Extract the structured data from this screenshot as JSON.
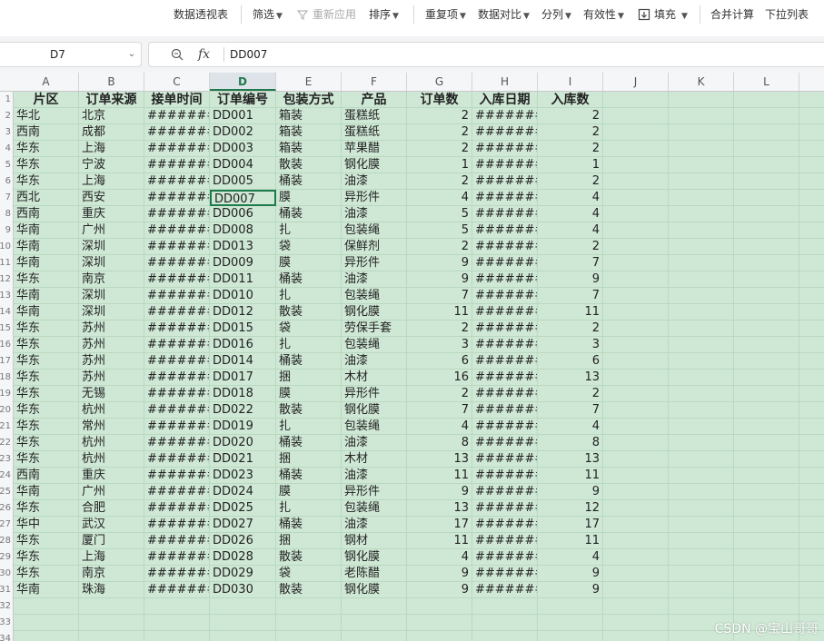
{
  "toolbar": {
    "pivot_table": "数据透视表",
    "filter": "筛选",
    "reapply": "重新应用",
    "sort": "排序",
    "duplicates": "重复项",
    "data_compare": "数据对比",
    "split": "分列",
    "validity": "有效性",
    "fill": "填充",
    "merge_calc": "合并计算",
    "dropdown_list": "下拉列表"
  },
  "formula_bar": {
    "name_box": "D7",
    "fx_label": "fx",
    "value": "DD007"
  },
  "sheet": {
    "columns": [
      "A",
      "B",
      "C",
      "D",
      "E",
      "F",
      "G",
      "H",
      "I",
      "J",
      "K",
      "L"
    ],
    "selected_column": "D",
    "row_numbers": [
      "1",
      "2",
      "3",
      "4",
      "5",
      "6",
      "7",
      "8",
      "9",
      "10",
      "11",
      "12",
      "13",
      "14",
      "15",
      "16",
      "17",
      "18",
      "19",
      "20",
      "21",
      "22",
      "23",
      "24",
      "25",
      "26",
      "27",
      "28",
      "29",
      "30",
      "31",
      "32",
      "33",
      "34"
    ],
    "headers": [
      "片区",
      "订单来源",
      "接单时间",
      "订单编号",
      "包装方式",
      "产品",
      "订单数",
      "入库日期",
      "入库数"
    ],
    "rows": [
      [
        "华北",
        "北京",
        "########",
        "DD001",
        "箱装",
        "蛋糕纸",
        "2",
        "########",
        "2"
      ],
      [
        "西南",
        "成都",
        "########",
        "DD002",
        "箱装",
        "蛋糕纸",
        "2",
        "########",
        "2"
      ],
      [
        "华东",
        "上海",
        "########",
        "DD003",
        "箱装",
        "苹果醋",
        "2",
        "########",
        "2"
      ],
      [
        "华东",
        "宁波",
        "########",
        "DD004",
        "散装",
        "钢化膜",
        "1",
        "########",
        "1"
      ],
      [
        "华东",
        "上海",
        "########",
        "DD005",
        "桶装",
        "油漆",
        "2",
        "########",
        "2"
      ],
      [
        "西北",
        "西安",
        "########",
        "DD007",
        "膜",
        "异形件",
        "4",
        "########",
        "4"
      ],
      [
        "西南",
        "重庆",
        "########",
        "DD006",
        "桶装",
        "油漆",
        "5",
        "########",
        "4"
      ],
      [
        "华南",
        "广州",
        "########",
        "DD008",
        "扎",
        "包装绳",
        "5",
        "########",
        "4"
      ],
      [
        "华南",
        "深圳",
        "########",
        "DD013",
        "袋",
        "保鲜剂",
        "2",
        "########",
        "2"
      ],
      [
        "华南",
        "深圳",
        "########",
        "DD009",
        "膜",
        "异形件",
        "9",
        "########",
        "7"
      ],
      [
        "华东",
        "南京",
        "########",
        "DD011",
        "桶装",
        "油漆",
        "9",
        "########",
        "9"
      ],
      [
        "华南",
        "深圳",
        "########",
        "DD010",
        "扎",
        "包装绳",
        "7",
        "########",
        "7"
      ],
      [
        "华南",
        "深圳",
        "########",
        "DD012",
        "散装",
        "钢化膜",
        "11",
        "########",
        "11"
      ],
      [
        "华东",
        "苏州",
        "########",
        "DD015",
        "袋",
        "劳保手套",
        "2",
        "########",
        "2"
      ],
      [
        "华东",
        "苏州",
        "########",
        "DD016",
        "扎",
        "包装绳",
        "3",
        "########",
        "3"
      ],
      [
        "华东",
        "苏州",
        "########",
        "DD014",
        "桶装",
        "油漆",
        "6",
        "########",
        "6"
      ],
      [
        "华东",
        "苏州",
        "########",
        "DD017",
        "捆",
        "木材",
        "16",
        "########",
        "13"
      ],
      [
        "华东",
        "无锡",
        "########",
        "DD018",
        "膜",
        "异形件",
        "2",
        "########",
        "2"
      ],
      [
        "华东",
        "杭州",
        "########",
        "DD022",
        "散装",
        "钢化膜",
        "7",
        "########",
        "7"
      ],
      [
        "华东",
        "常州",
        "########",
        "DD019",
        "扎",
        "包装绳",
        "4",
        "########",
        "4"
      ],
      [
        "华东",
        "杭州",
        "########",
        "DD020",
        "桶装",
        "油漆",
        "8",
        "########",
        "8"
      ],
      [
        "华东",
        "杭州",
        "########",
        "DD021",
        "捆",
        "木材",
        "13",
        "########",
        "13"
      ],
      [
        "西南",
        "重庆",
        "########",
        "DD023",
        "桶装",
        "油漆",
        "11",
        "########",
        "11"
      ],
      [
        "华南",
        "广州",
        "########",
        "DD024",
        "膜",
        "异形件",
        "9",
        "########",
        "9"
      ],
      [
        "华东",
        "合肥",
        "########",
        "DD025",
        "扎",
        "包装绳",
        "13",
        "########",
        "12"
      ],
      [
        "华中",
        "武汉",
        "########",
        "DD027",
        "桶装",
        "油漆",
        "17",
        "########",
        "17"
      ],
      [
        "华东",
        "厦门",
        "########",
        "DD026",
        "捆",
        "钢材",
        "11",
        "########",
        "11"
      ],
      [
        "华东",
        "上海",
        "########",
        "DD028",
        "散装",
        "钢化膜",
        "4",
        "########",
        "4"
      ],
      [
        "华东",
        "南京",
        "########",
        "DD029",
        "袋",
        "老陈醋",
        "9",
        "########",
        "9"
      ],
      [
        "华南",
        "珠海",
        "########",
        "DD030",
        "散装",
        "钢化膜",
        "9",
        "########",
        "9"
      ]
    ]
  },
  "watermark": "CSDN @宝山哥哥"
}
